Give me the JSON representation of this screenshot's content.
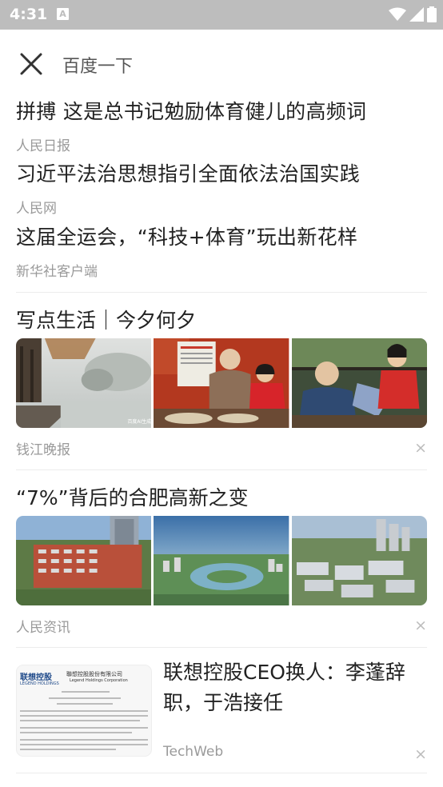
{
  "status": {
    "time": "4:31",
    "notif_letter": "A"
  },
  "header": {
    "query": "百度一下"
  },
  "hot_list": [
    {
      "title": "拼搏 这是总书记勉励体育健儿的高频词",
      "source": "人民日报"
    },
    {
      "title": "习近平法治思想指引全面依法治国实践",
      "source": "人民网"
    },
    {
      "title": "这届全运会，“科技+体育”玩出新花样",
      "source": "新华社客户端"
    }
  ],
  "feed": [
    {
      "title": "写点生活｜今夕何夕",
      "source": "钱江晚报",
      "images": [
        "misty-lake-bridge-photo",
        "grandpa-child-calendar-photo",
        "grandparent-child-knitting-photo"
      ]
    },
    {
      "title": "“7%”背后的合肥高新之变",
      "source": "人民资讯",
      "images": [
        "office-building-aerial-photo",
        "high-tech-park-aerial-photo",
        "industrial-district-aerial-photo"
      ]
    },
    {
      "title": "联想控股CEO换人：李蓬辞职，于浩接任",
      "source": "TechWeb",
      "thumb": {
        "company": "联想控股",
        "company_en": "LEGEND HOLDINGS",
        "company_full": "聯想控股股份有限公司",
        "company_full_en": "Legend Holdings Corporation"
      }
    }
  ],
  "dismiss_label": "×",
  "image_caption": "百度AI生成"
}
